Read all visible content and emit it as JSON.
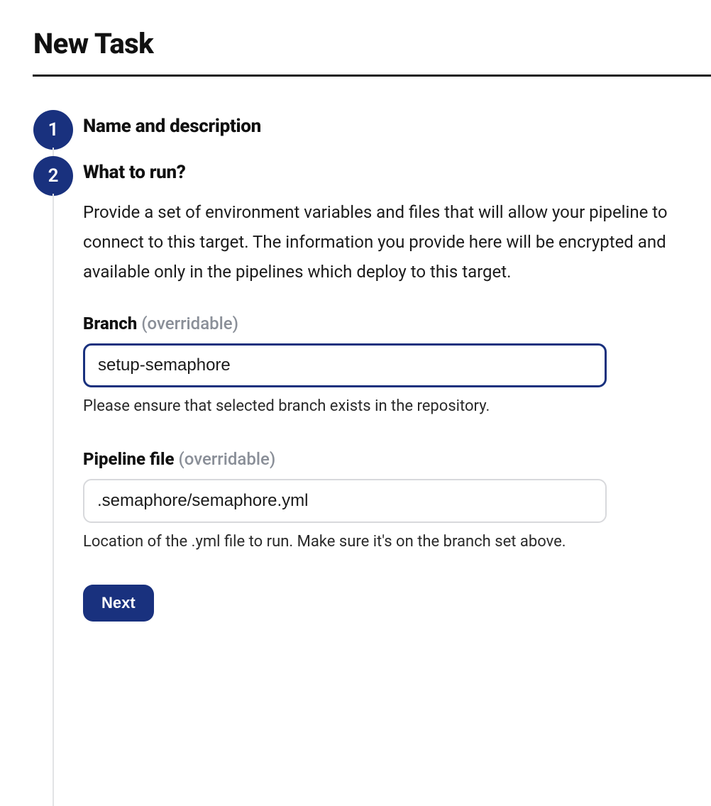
{
  "page": {
    "title": "New Task"
  },
  "steps": {
    "one": {
      "number": "1",
      "title": "Name and description"
    },
    "two": {
      "number": "2",
      "title": "What to run?",
      "description": "Provide a set of environment variables and files that will allow your pipeline to connect to this target. The information you provide here will be encrypted and available only in the pipelines which deploy to this target.",
      "branch": {
        "label": "Branch",
        "hint": " (overridable)",
        "value": "setup-semaphore",
        "helper": "Please ensure that selected branch exists in the repository."
      },
      "pipeline": {
        "label": "Pipeline file",
        "hint": " (overridable)",
        "value": ".semaphore/semaphore.yml",
        "helper": "Location of the .yml file to run. Make sure it's on the branch set above."
      },
      "next_label": "Next"
    }
  }
}
